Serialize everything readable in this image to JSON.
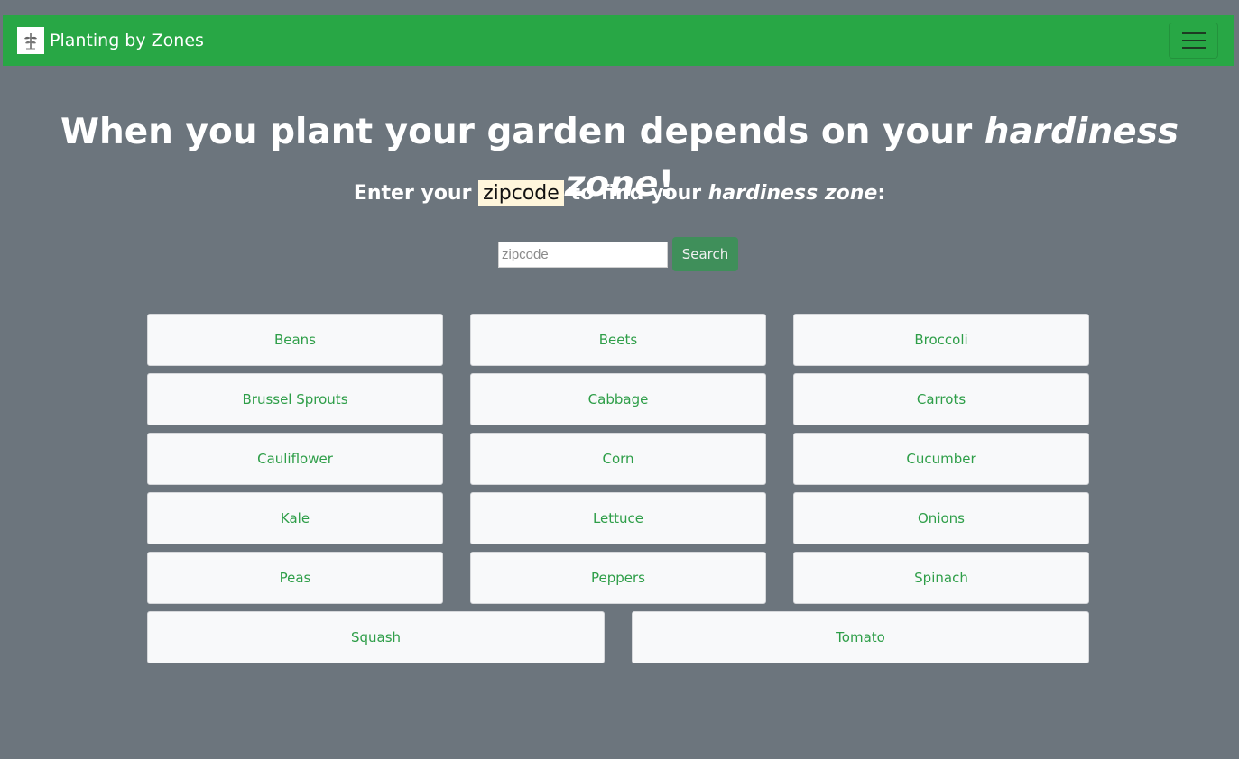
{
  "navbar": {
    "brand": "Planting by Zones",
    "logo_icon": "seedling-logo-icon",
    "toggler_icon": "hamburger-menu-icon",
    "color": "#28a745"
  },
  "hero": {
    "headline_prefix": "When you plant your garden depends on your ",
    "headline_emphasis": "hardiness zone",
    "headline_suffix": "!",
    "sub_prefix": "Enter your ",
    "sub_highlight": "zipcode",
    "sub_middle": " to find your ",
    "sub_emphasis": "hardiness zone",
    "sub_suffix": ":"
  },
  "search": {
    "value": "",
    "placeholder": "zipcode",
    "button_label": "Search"
  },
  "vegetables": {
    "rows": [
      [
        "Beans",
        "Beets",
        "Broccoli"
      ],
      [
        "Brussel Sprouts",
        "Cabbage",
        "Carrots"
      ],
      [
        "Cauliflower",
        "Corn",
        "Cucumber"
      ],
      [
        "Kale",
        "Lettuce",
        "Onions"
      ],
      [
        "Peas",
        "Peppers",
        "Spinach"
      ],
      [
        "Squash",
        "Tomato"
      ]
    ]
  },
  "colors": {
    "page_background": "#6c757d",
    "tile_text": "#2e9e48",
    "search_button": "#3f8f5a",
    "highlight": "#fff6dc"
  }
}
